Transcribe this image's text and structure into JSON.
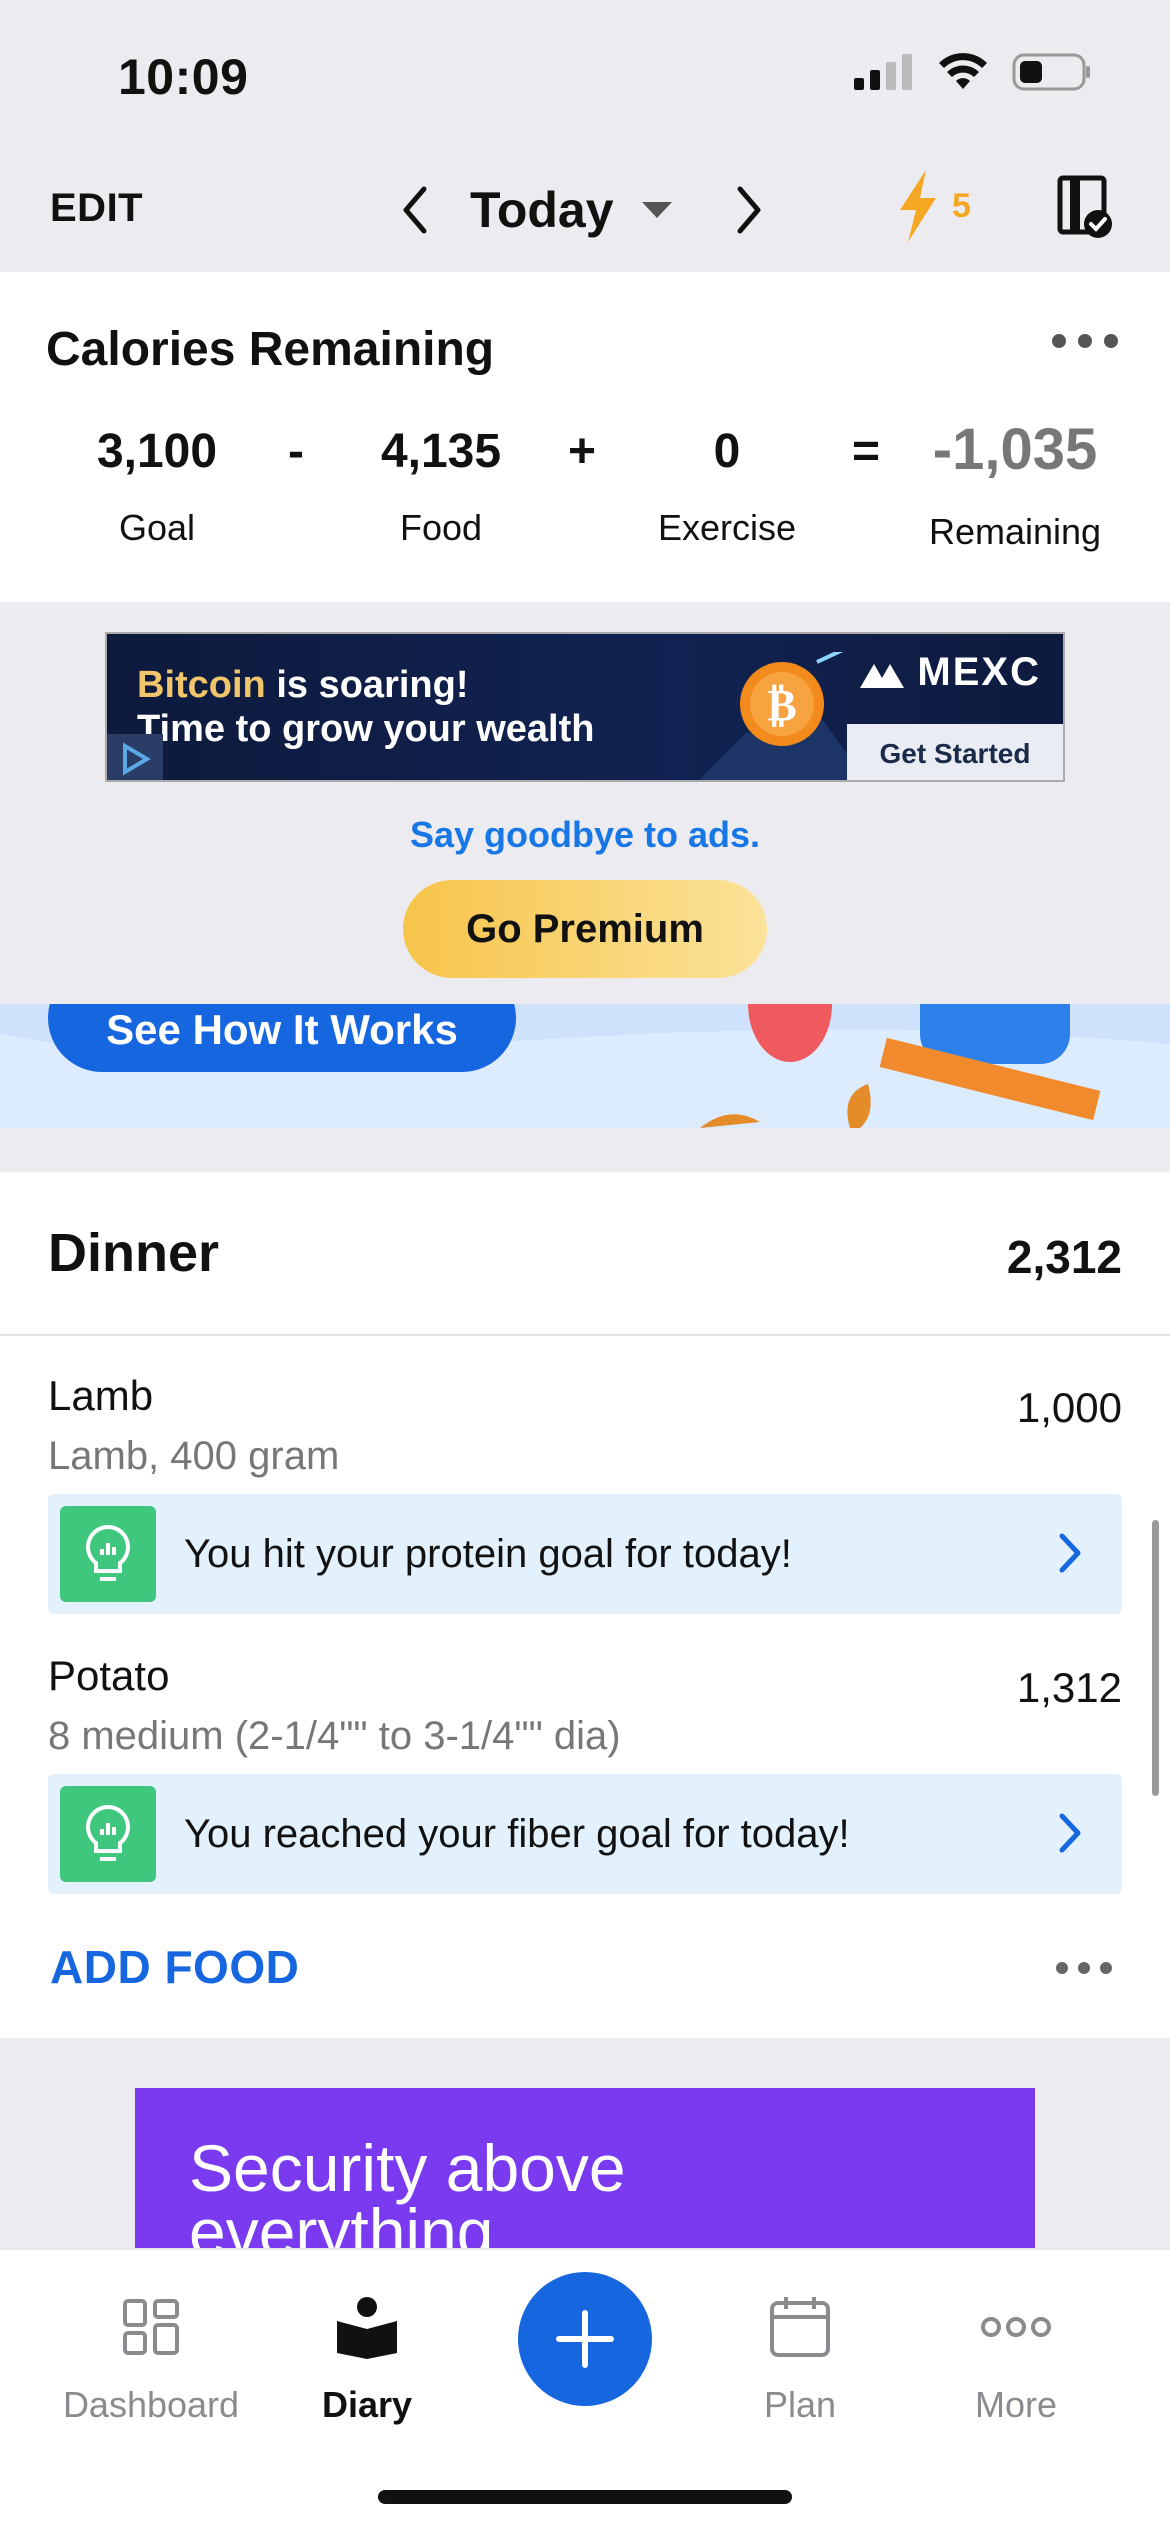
{
  "status_bar": {
    "time": "10:09"
  },
  "header": {
    "edit_label": "EDIT",
    "date_label": "Today",
    "streak_count": "5"
  },
  "calories": {
    "title": "Calories Remaining",
    "goal_value": "3,100",
    "goal_label": "Goal",
    "minus": "-",
    "food_value": "4,135",
    "food_label": "Food",
    "plus": "+",
    "exercise_value": "0",
    "exercise_label": "Exercise",
    "equals": "=",
    "remaining_value": "-1,035",
    "remaining_label": "Remaining"
  },
  "ad": {
    "line1_highlight": "Bitcoin",
    "line1_rest": " is soaring!",
    "line2": "Time to grow your wealth",
    "brand": "MEXC",
    "cta": "Get Started",
    "goodbye_link": "Say goodbye to ads.",
    "premium_button": "Go Premium"
  },
  "promo": {
    "button_label": "See How It Works"
  },
  "dinner": {
    "title": "Dinner",
    "total": "2,312",
    "items": [
      {
        "name": "Lamb",
        "desc": "Lamb, 400 gram",
        "calories": "1,000",
        "insight": "You hit your protein goal for today!"
      },
      {
        "name": "Potato",
        "desc": "8 medium (2-1/4\"\" to 3-1/4\"\" dia)",
        "calories": "1,312",
        "insight": "You reached your fiber goal for today!"
      }
    ],
    "add_food": "ADD FOOD"
  },
  "bottom_ad": {
    "text": "Security above everything"
  },
  "tabs": [
    {
      "label": "Dashboard",
      "icon": "dashboard-grid-icon"
    },
    {
      "label": "Diary",
      "icon": "diary-book-icon"
    },
    {
      "label": "Plan",
      "icon": "calendar-icon"
    },
    {
      "label": "More",
      "icon": "more-dots-icon"
    }
  ],
  "colors": {
    "accent": "#1666e0",
    "streak": "#f5a623",
    "insight_icon": "#3fc77e",
    "premium": "#f7c44a"
  }
}
